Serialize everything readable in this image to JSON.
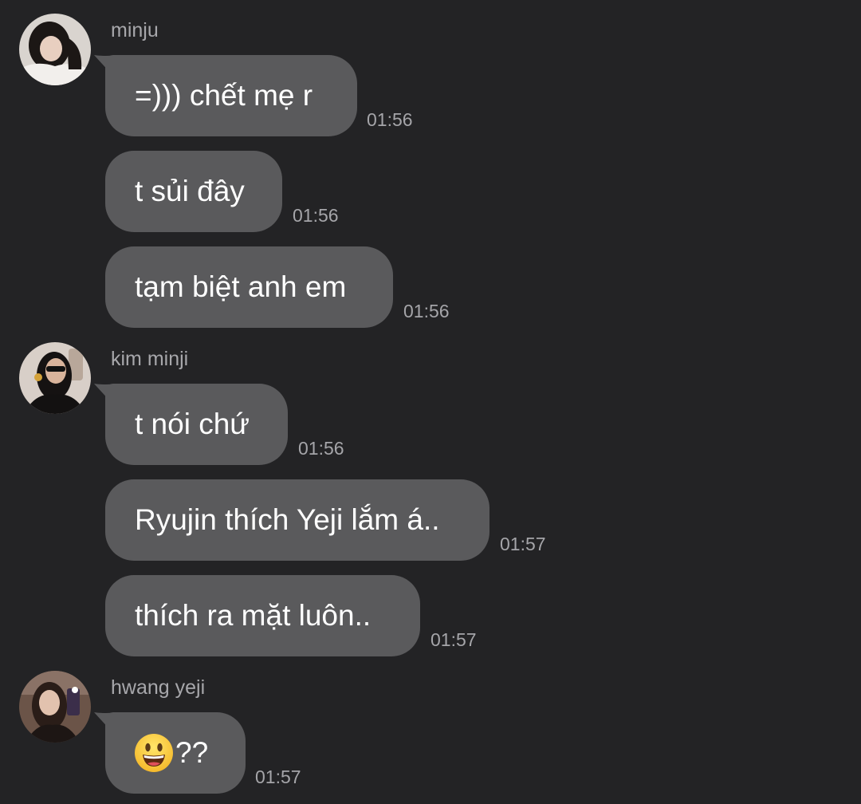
{
  "messages": [
    {
      "sender": "minju",
      "items": [
        {
          "text": "=))) chết mẹ r",
          "time": "01:56"
        },
        {
          "text": "t sủi đây",
          "time": "01:56"
        },
        {
          "text": "tạm biệt anh em",
          "time": "01:56"
        }
      ]
    },
    {
      "sender": "kim minji",
      "items": [
        {
          "text": "t nói chứ",
          "time": "01:56"
        },
        {
          "text": "Ryujin thích Yeji lắm á..",
          "time": "01:57"
        },
        {
          "text": "thích ra mặt luôn..",
          "time": "01:57"
        }
      ]
    },
    {
      "sender": "hwang yeji",
      "items": [
        {
          "emoji": "smiling-face-emoji",
          "text": "??",
          "time": "01:57"
        }
      ]
    }
  ],
  "colors": {
    "background": "#232325",
    "bubble": "#5a5a5c",
    "text": "#ffffff",
    "meta": "#a7a7ab"
  }
}
